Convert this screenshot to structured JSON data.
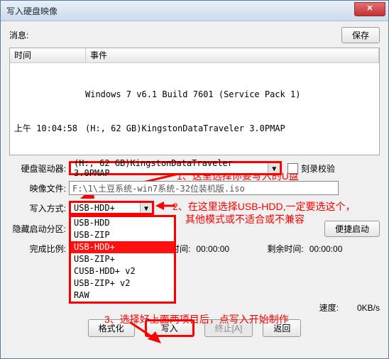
{
  "window": {
    "title": "写入硬盘映像"
  },
  "topbar": {
    "message_label": "消息:",
    "save_label": "保存"
  },
  "log": {
    "col_time": "时间",
    "col_event": "事件",
    "rows": [
      {
        "time": "",
        "event": "Windows 7 v6.1 Build 7601 (Service Pack 1)"
      },
      {
        "time": "上午 10:04:58",
        "event": "(H:, 62 GB)KingstonDataTraveler 3.0PMAP"
      }
    ]
  },
  "form": {
    "drive_label": "硬盘驱动器:",
    "drive_value": "(H:, 62 GB)KingstonDataTraveler 3.0PMAP",
    "verify_label": "刻录校验",
    "image_label": "映像文件:",
    "image_value": "F:\\1\\土豆系统-win7系统-32位装机版.iso",
    "write_mode_label": "写入方式:",
    "write_mode_value": "USB-HDD+",
    "write_mode_options": [
      "USB-HDD",
      "USB-ZIP",
      "USB-HDD+",
      "USB-ZIP+",
      "CUSB-HDD+ v2",
      "USB-ZIP+ v2",
      "RAW"
    ],
    "hidden_label": "隐藏启动分区:",
    "hidden_value": "",
    "bootmenu_label": "便捷启动",
    "done_label": "完成比例:",
    "done_value": "",
    "elapsed_label": "已用时间:",
    "elapsed_value": "00:00:00",
    "remain_label": "剩余时间:",
    "remain_value": "00:00:00",
    "speed_label": "速度:",
    "speed_value": "0KB/s"
  },
  "buttons": {
    "format": "格式化",
    "write": "写入",
    "abort": "终止[A]",
    "back": "返回"
  },
  "annotations": {
    "a1": "1、这里选择你要写入的U盘",
    "a2a": "2、在这里选择USB-HDD,一定要选这个，",
    "a2b": "其他模式或不适合或不兼容",
    "a3": "3、选择好上面两项目后，点写入开始制作"
  }
}
